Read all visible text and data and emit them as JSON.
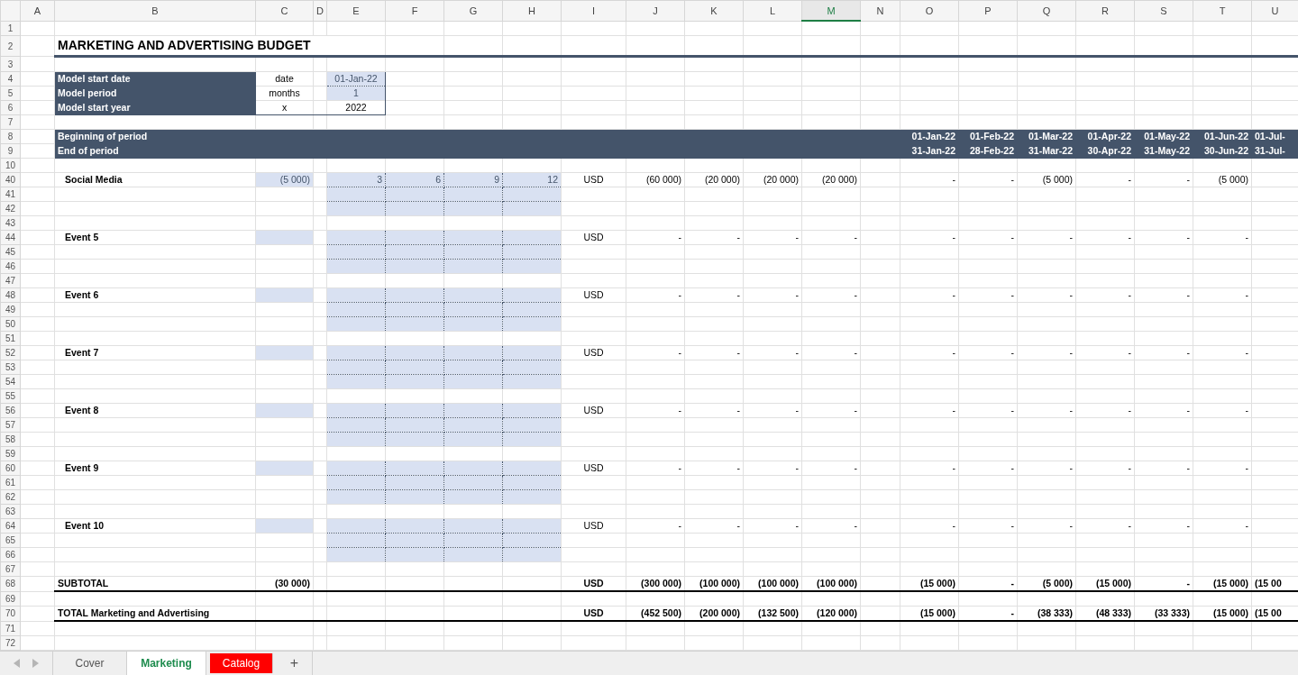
{
  "columns": [
    {
      "label": "A",
      "selected": false
    },
    {
      "label": "B",
      "selected": false
    },
    {
      "label": "C",
      "selected": false
    },
    {
      "label": "D",
      "selected": false
    },
    {
      "label": "E",
      "selected": false
    },
    {
      "label": "F",
      "selected": false
    },
    {
      "label": "G",
      "selected": false
    },
    {
      "label": "H",
      "selected": false
    },
    {
      "label": "I",
      "selected": false
    },
    {
      "label": "J",
      "selected": false
    },
    {
      "label": "K",
      "selected": false
    },
    {
      "label": "L",
      "selected": false
    },
    {
      "label": "M",
      "selected": true
    },
    {
      "label": "N",
      "selected": false
    },
    {
      "label": "O",
      "selected": false
    },
    {
      "label": "P",
      "selected": false
    },
    {
      "label": "Q",
      "selected": false
    },
    {
      "label": "R",
      "selected": false
    },
    {
      "label": "S",
      "selected": false
    },
    {
      "label": "T",
      "selected": false
    },
    {
      "label": "U",
      "selected": false
    }
  ],
  "rows": [
    {
      "number": "1",
      "kind": "blank"
    },
    {
      "number": "2",
      "kind": "title",
      "text": "MARKETING AND ADVERTISING BUDGET"
    },
    {
      "number": "3",
      "kind": "blank"
    },
    {
      "number": "4",
      "kind": "param",
      "label": "Model start date",
      "unit": "date",
      "value": "01-Jan-22",
      "input": true
    },
    {
      "number": "5",
      "kind": "param",
      "label": "Model period",
      "unit": "months",
      "value": "1",
      "input": true
    },
    {
      "number": "6",
      "kind": "param",
      "label": "Model start year",
      "unit": "x",
      "value": "2022",
      "input": false
    },
    {
      "number": "7",
      "kind": "blank"
    },
    {
      "number": "8",
      "kind": "period",
      "label": "Beginning of period",
      "dates": [
        "01-Jan-22",
        "01-Feb-22",
        "01-Mar-22",
        "01-Apr-22",
        "01-May-22",
        "01-Jun-22",
        "01-Jul-"
      ]
    },
    {
      "number": "9",
      "kind": "period",
      "label": "End of period",
      "dates": [
        "31-Jan-22",
        "28-Feb-22",
        "31-Mar-22",
        "30-Apr-22",
        "31-May-22",
        "30-Jun-22",
        "31-Jul-"
      ]
    },
    {
      "number": "10",
      "kind": "blank"
    },
    {
      "number": "40",
      "kind": "item",
      "label": "Social Media",
      "amount": "(5 000)",
      "schedule": [
        "3",
        "6",
        "9",
        "12"
      ],
      "currency": "USD",
      "values": [
        "(60 000)",
        "(20 000)",
        "(20 000)",
        "(20 000)"
      ],
      "period_values": [
        "-",
        "-",
        "(5 000)",
        "-",
        "-",
        "(5 000)"
      ]
    },
    {
      "number": "41",
      "kind": "input_band"
    },
    {
      "number": "42",
      "kind": "input_band"
    },
    {
      "number": "43",
      "kind": "blank"
    },
    {
      "number": "44",
      "kind": "item",
      "label": "Event 5",
      "currency": "USD",
      "values": [
        "-",
        "-",
        "-",
        "-"
      ],
      "period_values": [
        "-",
        "-",
        "-",
        "-",
        "-",
        "-"
      ]
    },
    {
      "number": "45",
      "kind": "input_band"
    },
    {
      "number": "46",
      "kind": "input_band"
    },
    {
      "number": "47",
      "kind": "blank"
    },
    {
      "number": "48",
      "kind": "item",
      "label": "Event 6",
      "currency": "USD",
      "values": [
        "-",
        "-",
        "-",
        "-"
      ],
      "period_values": [
        "-",
        "-",
        "-",
        "-",
        "-",
        "-"
      ]
    },
    {
      "number": "49",
      "kind": "input_band"
    },
    {
      "number": "50",
      "kind": "input_band"
    },
    {
      "number": "51",
      "kind": "blank"
    },
    {
      "number": "52",
      "kind": "item",
      "label": "Event 7",
      "currency": "USD",
      "values": [
        "-",
        "-",
        "-",
        "-"
      ],
      "period_values": [
        "-",
        "-",
        "-",
        "-",
        "-",
        "-"
      ]
    },
    {
      "number": "53",
      "kind": "input_band"
    },
    {
      "number": "54",
      "kind": "input_band"
    },
    {
      "number": "55",
      "kind": "blank"
    },
    {
      "number": "56",
      "kind": "item",
      "label": "Event 8",
      "currency": "USD",
      "values": [
        "-",
        "-",
        "-",
        "-"
      ],
      "period_values": [
        "-",
        "-",
        "-",
        "-",
        "-",
        "-"
      ]
    },
    {
      "number": "57",
      "kind": "input_band"
    },
    {
      "number": "58",
      "kind": "input_band"
    },
    {
      "number": "59",
      "kind": "blank"
    },
    {
      "number": "60",
      "kind": "item",
      "label": "Event 9",
      "currency": "USD",
      "values": [
        "-",
        "-",
        "-",
        "-"
      ],
      "period_values": [
        "-",
        "-",
        "-",
        "-",
        "-",
        "-"
      ]
    },
    {
      "number": "61",
      "kind": "input_band"
    },
    {
      "number": "62",
      "kind": "input_band"
    },
    {
      "number": "63",
      "kind": "blank"
    },
    {
      "number": "64",
      "kind": "item",
      "label": "Event 10",
      "currency": "USD",
      "values": [
        "-",
        "-",
        "-",
        "-"
      ],
      "period_values": [
        "-",
        "-",
        "-",
        "-",
        "-",
        "-"
      ]
    },
    {
      "number": "65",
      "kind": "input_band"
    },
    {
      "number": "66",
      "kind": "input_band"
    },
    {
      "number": "67",
      "kind": "blank"
    },
    {
      "number": "68",
      "kind": "subtotal",
      "label": "SUBTOTAL",
      "amount": "(30 000)",
      "currency": "USD",
      "values": [
        "(300 000)",
        "(100 000)",
        "(100 000)",
        "(100 000)"
      ],
      "period_values": [
        "(15 000)",
        "-",
        "(5 000)",
        "(15 000)",
        "-",
        "(15 000)",
        "(15 00"
      ]
    },
    {
      "number": "69",
      "kind": "blank"
    },
    {
      "number": "70",
      "kind": "total",
      "label": "TOTAL Marketing and Advertising",
      "currency": "USD",
      "values": [
        "(452 500)",
        "(200 000)",
        "(132 500)",
        "(120 000)"
      ],
      "period_values": [
        "(15 000)",
        "-",
        "(38 333)",
        "(48 333)",
        "(33 333)",
        "(15 000)",
        "(15 00"
      ]
    },
    {
      "number": "71",
      "kind": "blank"
    },
    {
      "number": "72",
      "kind": "blank"
    }
  ],
  "sheet_tabs": [
    {
      "label": "Cover",
      "selected": false
    },
    {
      "label": "Marketing",
      "selected": true
    },
    {
      "label": "Catalog",
      "selected": false,
      "color": "#ff0000"
    }
  ],
  "add_sheet": "+"
}
